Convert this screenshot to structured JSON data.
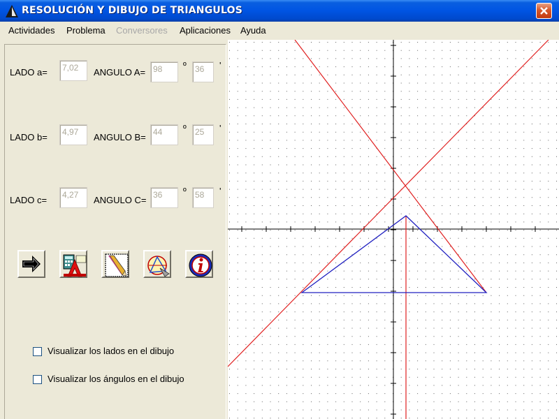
{
  "window": {
    "title": "RESOLUCIÓN Y DIBUJO DE TRIANGULOS"
  },
  "menu": [
    "Actividades",
    "Problema",
    "Conversores",
    "Aplicaciones",
    "Ayuda"
  ],
  "menu_disabled": [
    "Conversores"
  ],
  "rows": [
    {
      "lado_label": "LADO a=",
      "lado_value": "7,02",
      "angulo_label": "ANGULO A=",
      "deg": "98",
      "deg_symbol": "º",
      "min": "36",
      "min_symbol": "'"
    },
    {
      "lado_label": "LADO  b=",
      "lado_value": "4,97",
      "angulo_label": "ANGULO B=",
      "deg": "44",
      "deg_symbol": "º",
      "min": "25",
      "min_symbol": "'"
    },
    {
      "lado_label": "LADO c=",
      "lado_value": "4,27",
      "angulo_label": "ANGULO C=",
      "deg": "36",
      "deg_symbol": "º",
      "min": "58",
      "min_symbol": "'"
    }
  ],
  "toolbar": [
    "arrow-next-icon",
    "calculator-icon",
    "pencil-draw-icon",
    "triangle-tools-icon",
    "info-icon"
  ],
  "options": [
    {
      "label": "Visualizar los lados en el dibujo",
      "checked": false
    },
    {
      "label": "Visualizar los ángulos en el dibujo",
      "checked": false
    }
  ],
  "colors": {
    "triangle": "#2020C0",
    "lines": "#E02020",
    "axes": "#000000",
    "grid": "#606060"
  }
}
